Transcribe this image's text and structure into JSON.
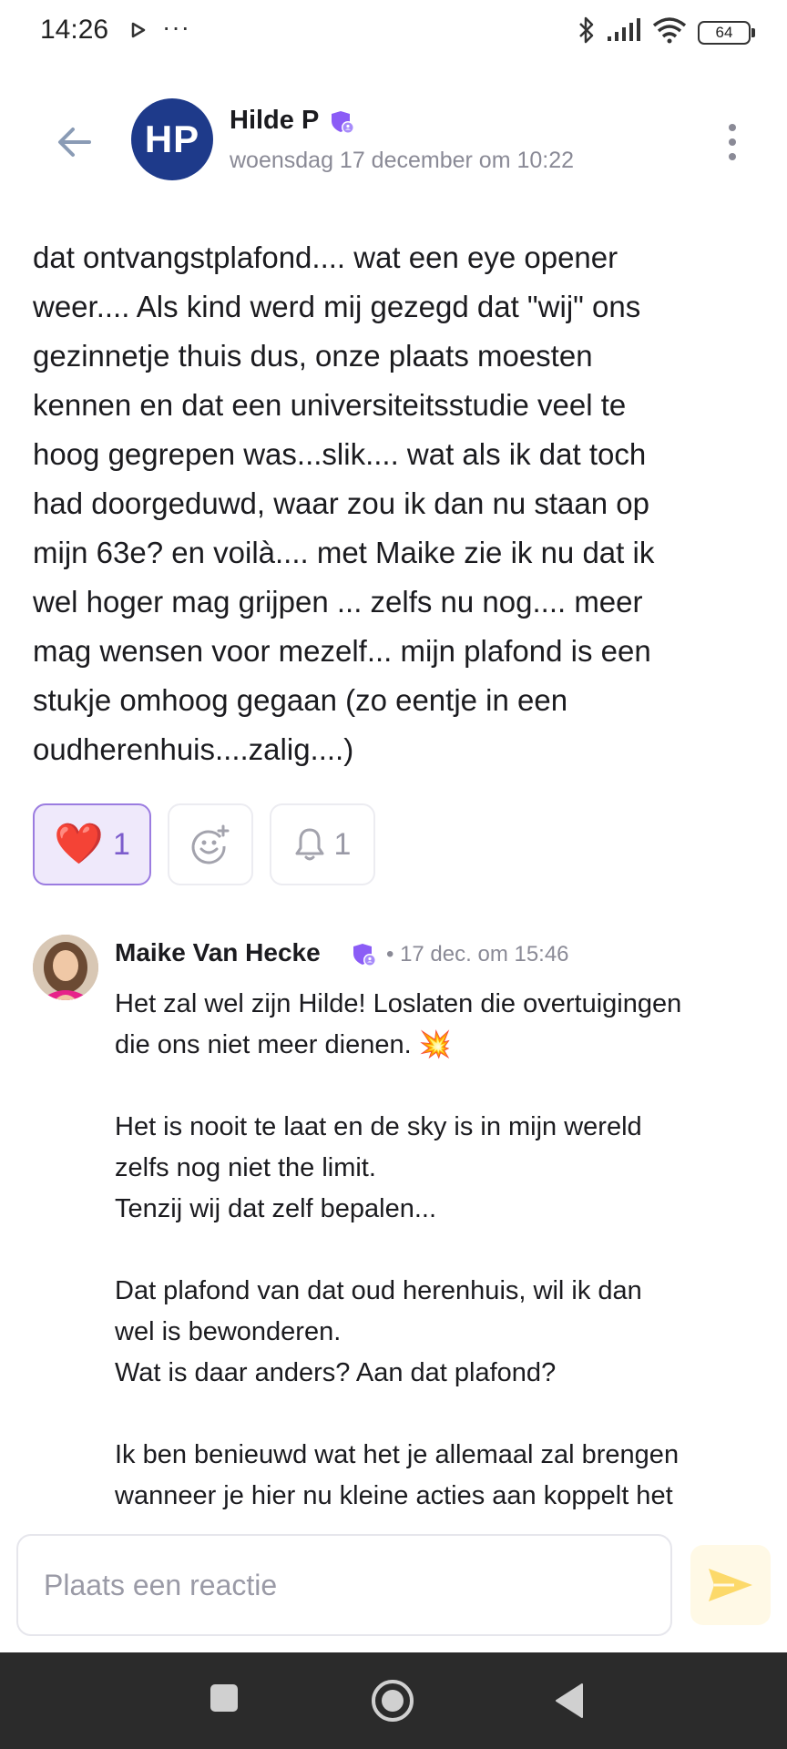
{
  "status_bar": {
    "time": "14:26",
    "more_dots": "···",
    "battery": "64"
  },
  "header": {
    "avatar_initials": "HP",
    "author_name": "Hilde P",
    "date": "woensdag 17 december om 10:22"
  },
  "post": {
    "body": "dat ontvangstplafond.... wat een eye opener\nweer.... Als kind werd mij gezegd dat \"wij\" ons\ngezinnetje thuis dus, onze plaats moesten\nkennen en dat een universiteitsstudie veel te\nhoog gegrepen was...slik.... wat als ik dat toch\nhad doorgeduwd, waar zou ik dan nu staan op\nmijn 63e? en voilà.... met Maike zie ik nu dat ik\nwel hoger mag grijpen ... zelfs nu nog.... meer\nmag wensen voor mezelf... mijn plafond is een\nstukje omhoog gegaan (zo eentje in een\noudherenhuis....zalig....)"
  },
  "reactions": {
    "heart_emoji": "❤️",
    "heart_count": "1",
    "bell_count": "1"
  },
  "comment": {
    "author": "Maike Van Hecke",
    "meta": "• 17 dec. om 15:46",
    "body": "Het zal wel zijn Hilde! Loslaten die overtuigingen\ndie ons niet meer dienen. 💥\n\nHet is nooit te laat en de sky is in mijn wereld\nzelfs nog niet the limit.\nTenzij wij dat zelf bepalen...\n\nDat plafond van dat oud herenhuis, wil ik dan\nwel is bewonderen.\nWat is daar anders? Aan dat plafond?\n\nIk ben benieuwd wat het je allemaal zal brengen\nwanneer je hier nu kleine acties aan koppelt het"
  },
  "reply": {
    "placeholder": "Plaats een reactie"
  },
  "colors": {
    "avatar_bg": "#1e3a8a",
    "badge": "#8b5cf6",
    "heart_border": "#9b7ce0",
    "heart_bg": "#efe9fb",
    "send_icon": "#fcd96a",
    "nav_bg": "#2b2b2b"
  },
  "icons": [
    "back-arrow-icon",
    "verified-badge-icon",
    "more-vert-icon",
    "add-emoji-icon",
    "bell-icon",
    "send-icon",
    "bluetooth-icon",
    "signal-icon",
    "wifi-icon",
    "battery-icon",
    "recents-icon",
    "home-icon",
    "back-triangle-icon"
  ]
}
